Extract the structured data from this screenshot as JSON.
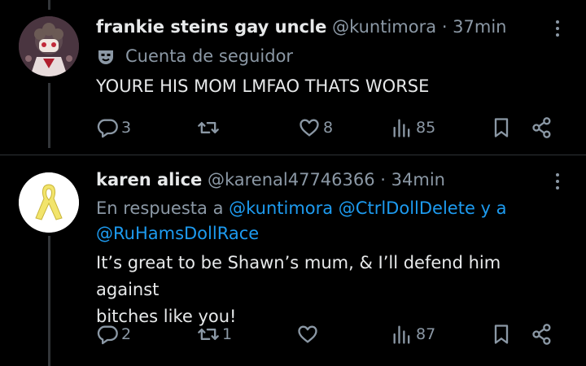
{
  "posts": [
    {
      "display_name": "frankie steins gay uncle",
      "handle": "@kuntimora",
      "time": "· 37min",
      "badge_text": "Cuenta de seguidor",
      "text": "YOURE HIS MOM LMFAO THATS WORSE",
      "stats": {
        "replies": "3",
        "reposts": "",
        "likes": "8",
        "views": "85"
      }
    },
    {
      "display_name": "karen alice",
      "handle": "@karenal47746366",
      "time": "· 34min",
      "reply_prefix": "En respuesta a",
      "reply_mentions_line1": "@kuntimora @CtrlDollDelete y a",
      "reply_mentions_line2": "@RuHamsDollRace",
      "text_line1": "It’s great to be Shawn’s mum, & I’ll defend him against",
      "text_line2": "bitches like you!",
      "stats": {
        "replies": "2",
        "reposts": "1",
        "likes": "",
        "views": "87"
      }
    }
  ],
  "colors": {
    "accent": "#1d9bf0",
    "muted": "#8b98a5",
    "text": "#e7e9ea",
    "ribbon": "#f2e46b"
  }
}
